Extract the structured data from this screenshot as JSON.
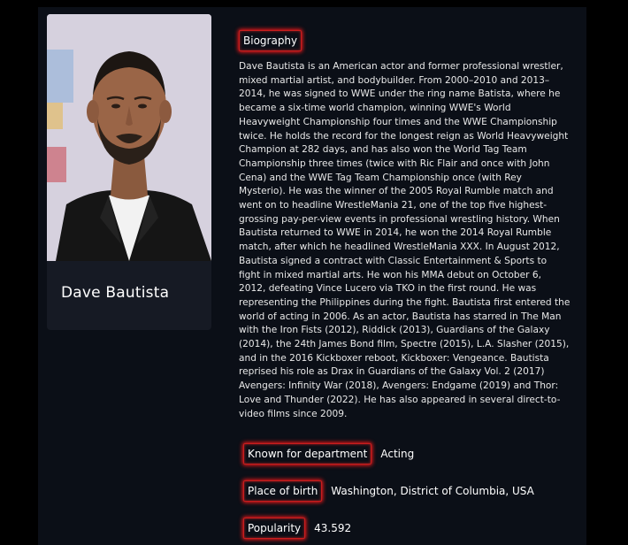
{
  "person": {
    "name": "Dave Bautista"
  },
  "biography": {
    "label": "Biography",
    "text": "Dave Bautista is an American actor and former professional wrestler, mixed martial artist, and bodybuilder. From 2000–2010 and 2013–2014, he was signed to WWE under the ring name Batista, where he became a six-time world champion, winning WWE's World Heavyweight Championship four times and the WWE Championship twice. He holds the record for the longest reign as World Heavyweight Champion at 282 days, and has also won the World Tag Team Championship three times (twice with Ric Flair and once with John Cena) and the WWE Tag Team Championship once (with Rey Mysterio). He was the winner of the 2005 Royal Rumble match and went on to headline WrestleMania 21, one of the top five highest-grossing pay-per-view events in professional wrestling history. When Bautista returned to WWE in 2014, he won the 2014 Royal Rumble match, after which he headlined WrestleMania XXX. In August 2012, Bautista signed a contract with Classic Entertainment & Sports to fight in mixed martial arts. He won his MMA debut on October 6, 2012, defeating Vince Lucero via TKO in the first round. He was representing the Philippines during the fight. Bautista first entered the world of acting in 2006. As an actor, Bautista has starred in The Man with the Iron Fists (2012), Riddick (2013), Guardians of the Galaxy (2014), the 24th James Bond film, Spectre (2015), L.A. Slasher (2015), and in the 2016 Kickboxer reboot, Kickboxer: Vengeance. Bautista reprised his role as Drax in Guardians of the Galaxy Vol. 2 (2017) Avengers: Infinity War (2018), Avengers: Endgame (2019) and Thor: Love and Thunder (2022). He has also appeared in several direct-to-video films since 2009."
  },
  "details": [
    {
      "label": "Known for department",
      "value": "Acting"
    },
    {
      "label": "Place of birth",
      "value": "Washington, District of Columbia, USA"
    },
    {
      "label": "Popularity",
      "value": "43.592"
    }
  ],
  "colors": {
    "page_bg": "#000000",
    "panel_bg": "#0b0f17",
    "card_bg": "#161a24",
    "tag_glow": "#ff1a1a"
  }
}
